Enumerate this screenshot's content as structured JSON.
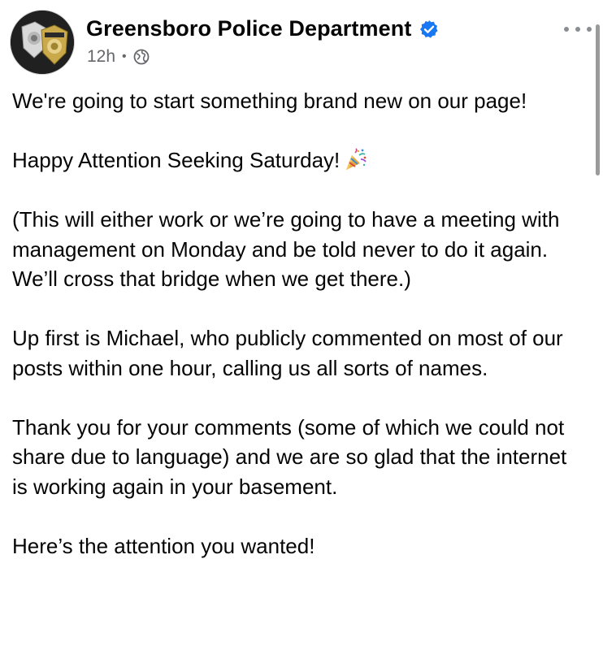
{
  "post": {
    "page_name": "Greensboro Police Department",
    "verified_icon": "verified-badge-icon",
    "timestamp": "12h",
    "separator": "•",
    "audience_icon": "globe-icon",
    "more_icon": "more-options-icon",
    "paragraphs": [
      "We're going to start something brand new on our page!",
      "Happy Attention Seeking Saturday!",
      "(This will either work or we’re going to have a meeting with management on Monday and be told never to do it again.  We’ll cross that bridge when we get there.)",
      "Up first is Michael, who publicly commented on most of our posts within one hour, calling us all sorts of names.",
      "Thank you for your comments (some of which we could not share due to language)  and we are so glad that the internet is working again in your basement.",
      "Here’s the attention you wanted!"
    ],
    "emoji": "party-popper-icon"
  },
  "colors": {
    "verified_blue": "#1877f2",
    "meta_gray": "#65676b",
    "text": "#050505"
  }
}
